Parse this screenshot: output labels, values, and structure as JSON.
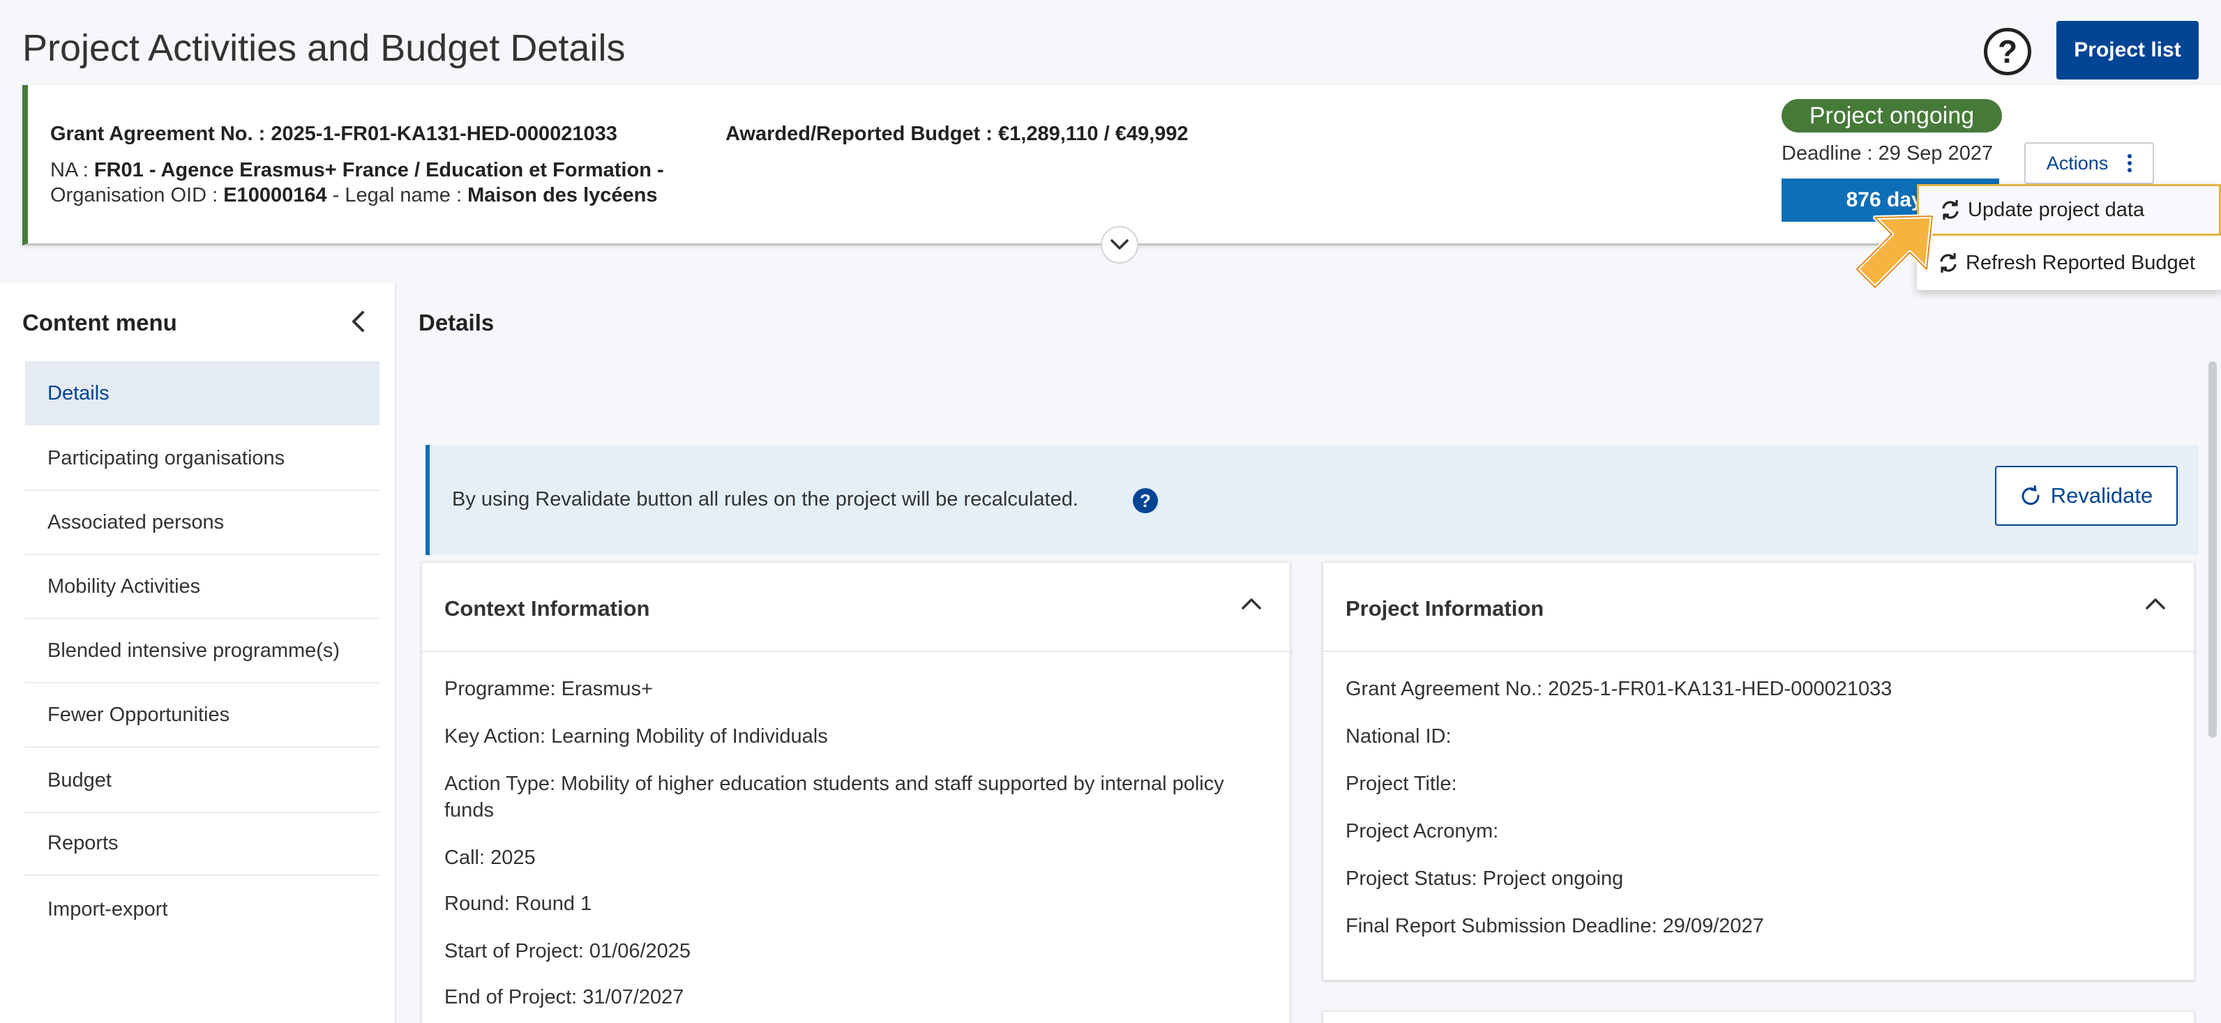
{
  "page": {
    "title": "Project Activities and Budget Details",
    "help_icon": "?",
    "project_list_label": "Project list"
  },
  "header": {
    "grant_label": "Grant Agreement No. :",
    "grant_no": "2025-1-FR01-KA131-HED-000021033",
    "budget_label": "Awarded/Reported Budget :",
    "budget_value": "€1,289,110 / €49,992",
    "na_label": "NA :",
    "na_value": "FR01 - Agence Erasmus+ France / Education et Formation -",
    "org_label": "Organisation OID :",
    "org_oid": "E10000164",
    "legal_label": "- Legal name :",
    "legal_name": "Maison des lycéens",
    "status": "Project ongoing",
    "deadline": "Deadline : 29 Sep 2027",
    "days_left": "876 days",
    "actions_label": "Actions",
    "status_color": "#467a39",
    "accent_color": "#004494"
  },
  "actions_menu": {
    "items": [
      {
        "label": "Update project data",
        "icon": "refresh-icon"
      },
      {
        "label": "Refresh Reported Budget",
        "icon": "refresh-icon"
      }
    ]
  },
  "sidebar": {
    "title": "Content menu",
    "items": [
      {
        "label": "Details"
      },
      {
        "label": "Participating organisations"
      },
      {
        "label": "Associated persons"
      },
      {
        "label": "Mobility Activities"
      },
      {
        "label": "Blended intensive programme(s)"
      },
      {
        "label": "Fewer Opportunities"
      },
      {
        "label": "Budget"
      },
      {
        "label": "Reports"
      },
      {
        "label": "Import-export"
      }
    ]
  },
  "main": {
    "title": "Details",
    "banner_text": "By using Revalidate button all rules on the project will be recalculated.",
    "banner_help": "?",
    "revalidate_label": "Revalidate"
  },
  "context_panel": {
    "title": "Context Information",
    "fields": [
      "Programme: Erasmus+",
      "Key Action: Learning Mobility of Individuals",
      "Action Type: Mobility of higher education students and staff supported by internal policy",
      "funds",
      "Call: 2025",
      "Round: Round 1",
      "Start of Project: 01/06/2025",
      "End of Project: 31/07/2027"
    ]
  },
  "project_panel": {
    "title": "Project Information",
    "fields": [
      "Grant Agreement No.: 2025-1-FR01-KA131-HED-000021033",
      "National ID:",
      "Project Title:",
      "Project Acronym:",
      "Project Status: Project ongoing",
      "Final Report Submission Deadline: 29/09/2027"
    ]
  }
}
